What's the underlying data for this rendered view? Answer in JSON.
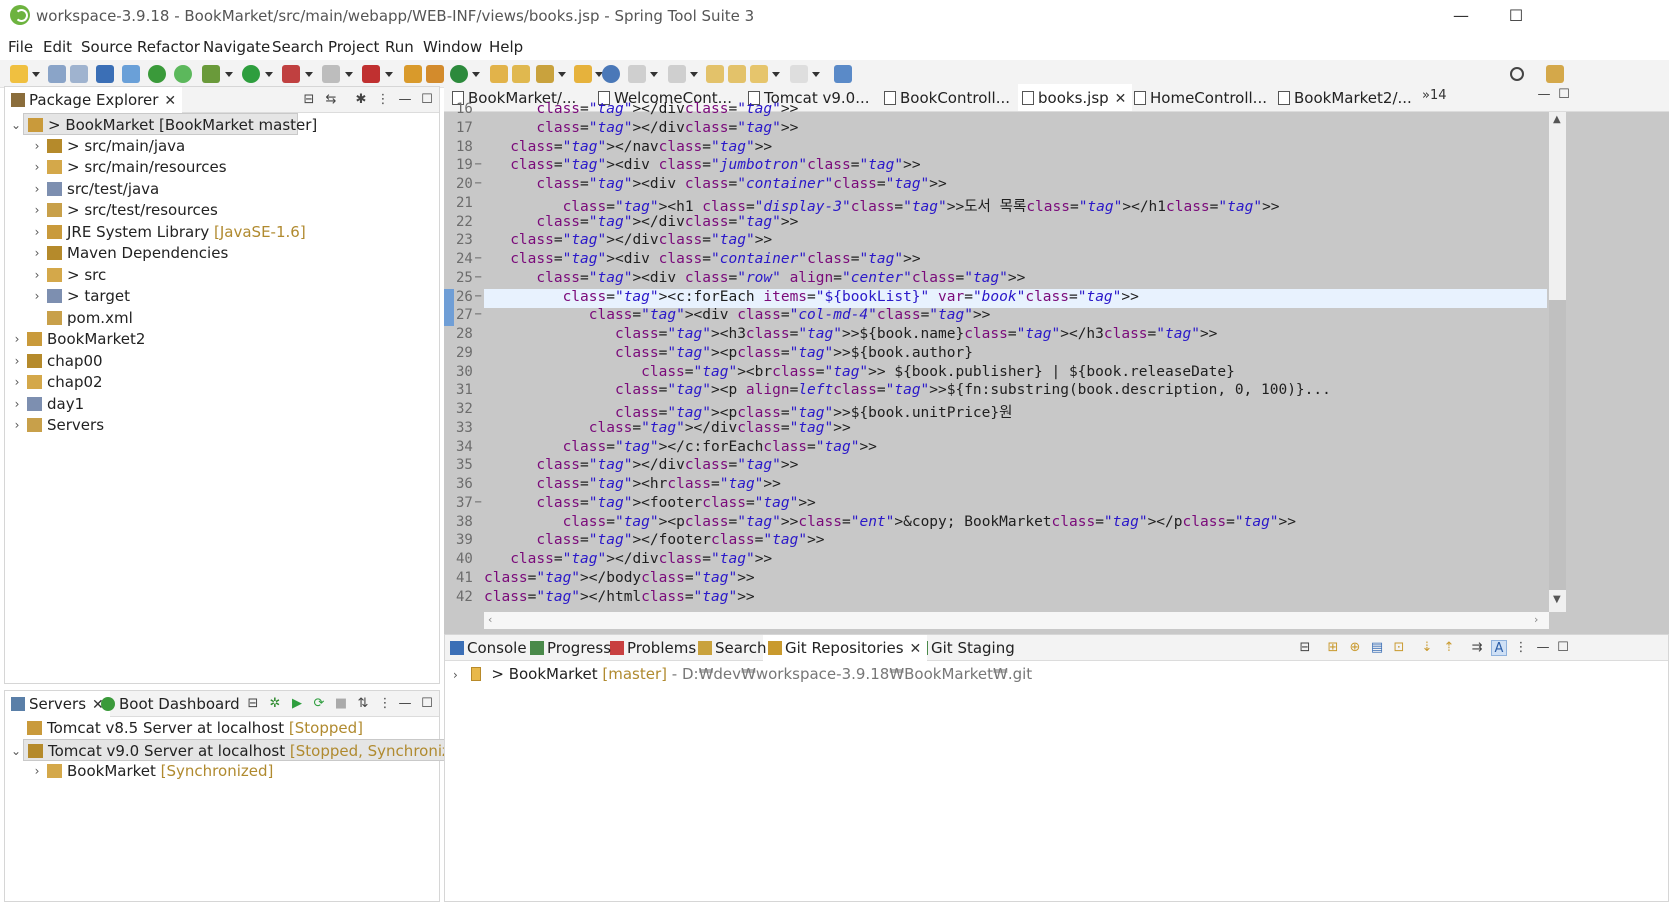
{
  "window": {
    "title": "workspace-3.9.18 - BookMarket/src/main/webapp/WEB-INF/views/books.jsp - Spring Tool Suite 3",
    "controls": {
      "minimize": "—",
      "maximize": "☐"
    }
  },
  "menu": [
    "File",
    "Edit",
    "Source",
    "Refactor",
    "Navigate",
    "Search",
    "Project",
    "Run",
    "Window",
    "Help"
  ],
  "package_explorer": {
    "tab_label": "Package Explorer",
    "tree": [
      {
        "label": "> BookMarket [BookMarket master]",
        "level": 0,
        "expanded": true,
        "selected": true
      },
      {
        "label": "> src/main/java",
        "level": 1
      },
      {
        "label": "> src/main/resources",
        "level": 1
      },
      {
        "label": "src/test/java",
        "level": 1
      },
      {
        "label": "> src/test/resources",
        "level": 1
      },
      {
        "label": "JRE System Library",
        "deco": "[JavaSE-1.6]",
        "level": 1
      },
      {
        "label": "Maven Dependencies",
        "level": 1
      },
      {
        "label": "> src",
        "level": 1
      },
      {
        "label": "> target",
        "level": 1
      },
      {
        "label": "pom.xml",
        "level": 1,
        "leaf": true
      },
      {
        "label": "BookMarket2",
        "level": 0
      },
      {
        "label": "chap00",
        "level": 0
      },
      {
        "label": "chap02",
        "level": 0
      },
      {
        "label": "day1",
        "level": 0
      },
      {
        "label": "Servers",
        "level": 0
      }
    ]
  },
  "servers": {
    "tabs": [
      "Servers",
      "Boot Dashboard"
    ],
    "rows": [
      {
        "label": "Tomcat v8.5 Server at localhost",
        "deco": "[Stopped]",
        "level": 0,
        "leaf": true
      },
      {
        "label": "Tomcat v9.0 Server at localhost",
        "deco": "[Stopped, Synchronized]",
        "level": 0,
        "expanded": true,
        "selected": true
      },
      {
        "label": "BookMarket",
        "deco": "[Synchronized]",
        "level": 1
      }
    ]
  },
  "editor": {
    "tabs": [
      "BookMarket/...",
      "WelcomeCont...",
      "Tomcat v9.0...",
      "BookControll...",
      "books.jsp",
      "HomeControll...",
      "BookMarket2/..."
    ],
    "active_tab": 4,
    "overflow": "»14",
    "line_numbers": [
      "16",
      "17",
      "18",
      "19",
      "20",
      "21",
      "22",
      "23",
      "24",
      "25",
      "26",
      "27",
      "28",
      "29",
      "30",
      "31",
      "32",
      "33",
      "34",
      "35",
      "36",
      "37",
      "38",
      "39",
      "40",
      "41",
      "42"
    ],
    "lines": [
      "      </div>",
      "      </div>",
      "   </nav>",
      "   <div class=\"jumbotron\">",
      "      <div class=\"container\">",
      "         <h1 class=\"display-3\">도서 목록</h1>",
      "      </div>",
      "   </div>",
      "   <div class=\"container\">",
      "      <div class=\"row\" align=\"center\">",
      "         <c:forEach items=\"${bookList}\" var=\"book\">",
      "            <div class=\"col-md-4\">",
      "               <h3>${book.name}</h3>",
      "               <p>${book.author}",
      "                  <br> ${book.publisher} | ${book.releaseDate}",
      "               <p align=left>${fn:substring(book.description, 0, 100)}...",
      "               <p>${book.unitPrice}원",
      "            </div>",
      "         </c:forEach>",
      "      </div>",
      "      <hr>",
      "      <footer>",
      "         <p>&copy; BookMarket</p>",
      "      </footer>",
      "   </div>",
      "</body>",
      "</html>"
    ],
    "current_line": "26"
  },
  "bottom_panel": {
    "tabs": [
      "Console",
      "Progress",
      "Problems",
      "Search",
      "Git Repositories",
      "Git Staging"
    ],
    "active_tab": 4,
    "repo": {
      "name": "> BookMarket",
      "branch": "[master]",
      "path": "- D:₩dev₩workspace-3.9.18₩BookMarket₩.git"
    }
  }
}
